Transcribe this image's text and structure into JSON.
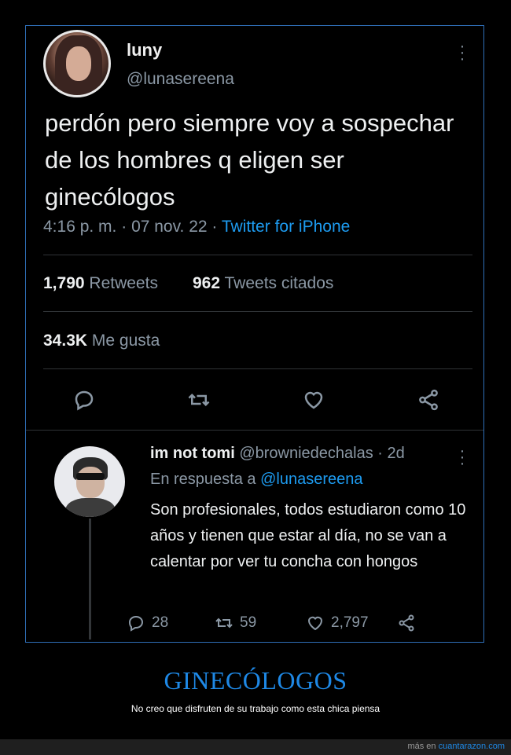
{
  "tweet": {
    "name": "luny",
    "handle": "@lunasereena",
    "text": "perdón pero siempre voy a sospechar de los hombres q eligen ser ginecólogos",
    "time": "4:16 p. m.",
    "date": "07 nov. 22",
    "source": "Twitter for iPhone",
    "retweets_count": "1,790",
    "retweets_label": "Retweets",
    "quotes_count": "962",
    "quotes_label": "Tweets citados",
    "likes_count": "34.3K",
    "likes_label": "Me gusta",
    "actions": [
      "reply-icon",
      "retweet-icon",
      "like-icon",
      "share-icon"
    ]
  },
  "reply": {
    "name": "im not tomi",
    "handle": "@browniedechalas",
    "age": "2d",
    "in_reply_prefix": "En respuesta a",
    "in_reply_handle": "@lunasereena",
    "text": "Son profesionales, todos estudiaron como 10 años y tienen que estar al día, no se van a calentar por ver tu concha con hongos",
    "reply_count": "28",
    "retweet_count": "59",
    "like_count": "2,797"
  },
  "caption": {
    "title": "GINECÓLOGOS",
    "subtitle": "No creo que disfruten de su trabajo como esta chica piensa"
  },
  "footer": {
    "prefix": "más en",
    "site": "cuantarazon.com"
  },
  "colors": {
    "accent": "#1d9bf0",
    "caption_blue": "#1e88e5",
    "frame_border": "#2f6fb8",
    "muted": "#8b98a5"
  }
}
